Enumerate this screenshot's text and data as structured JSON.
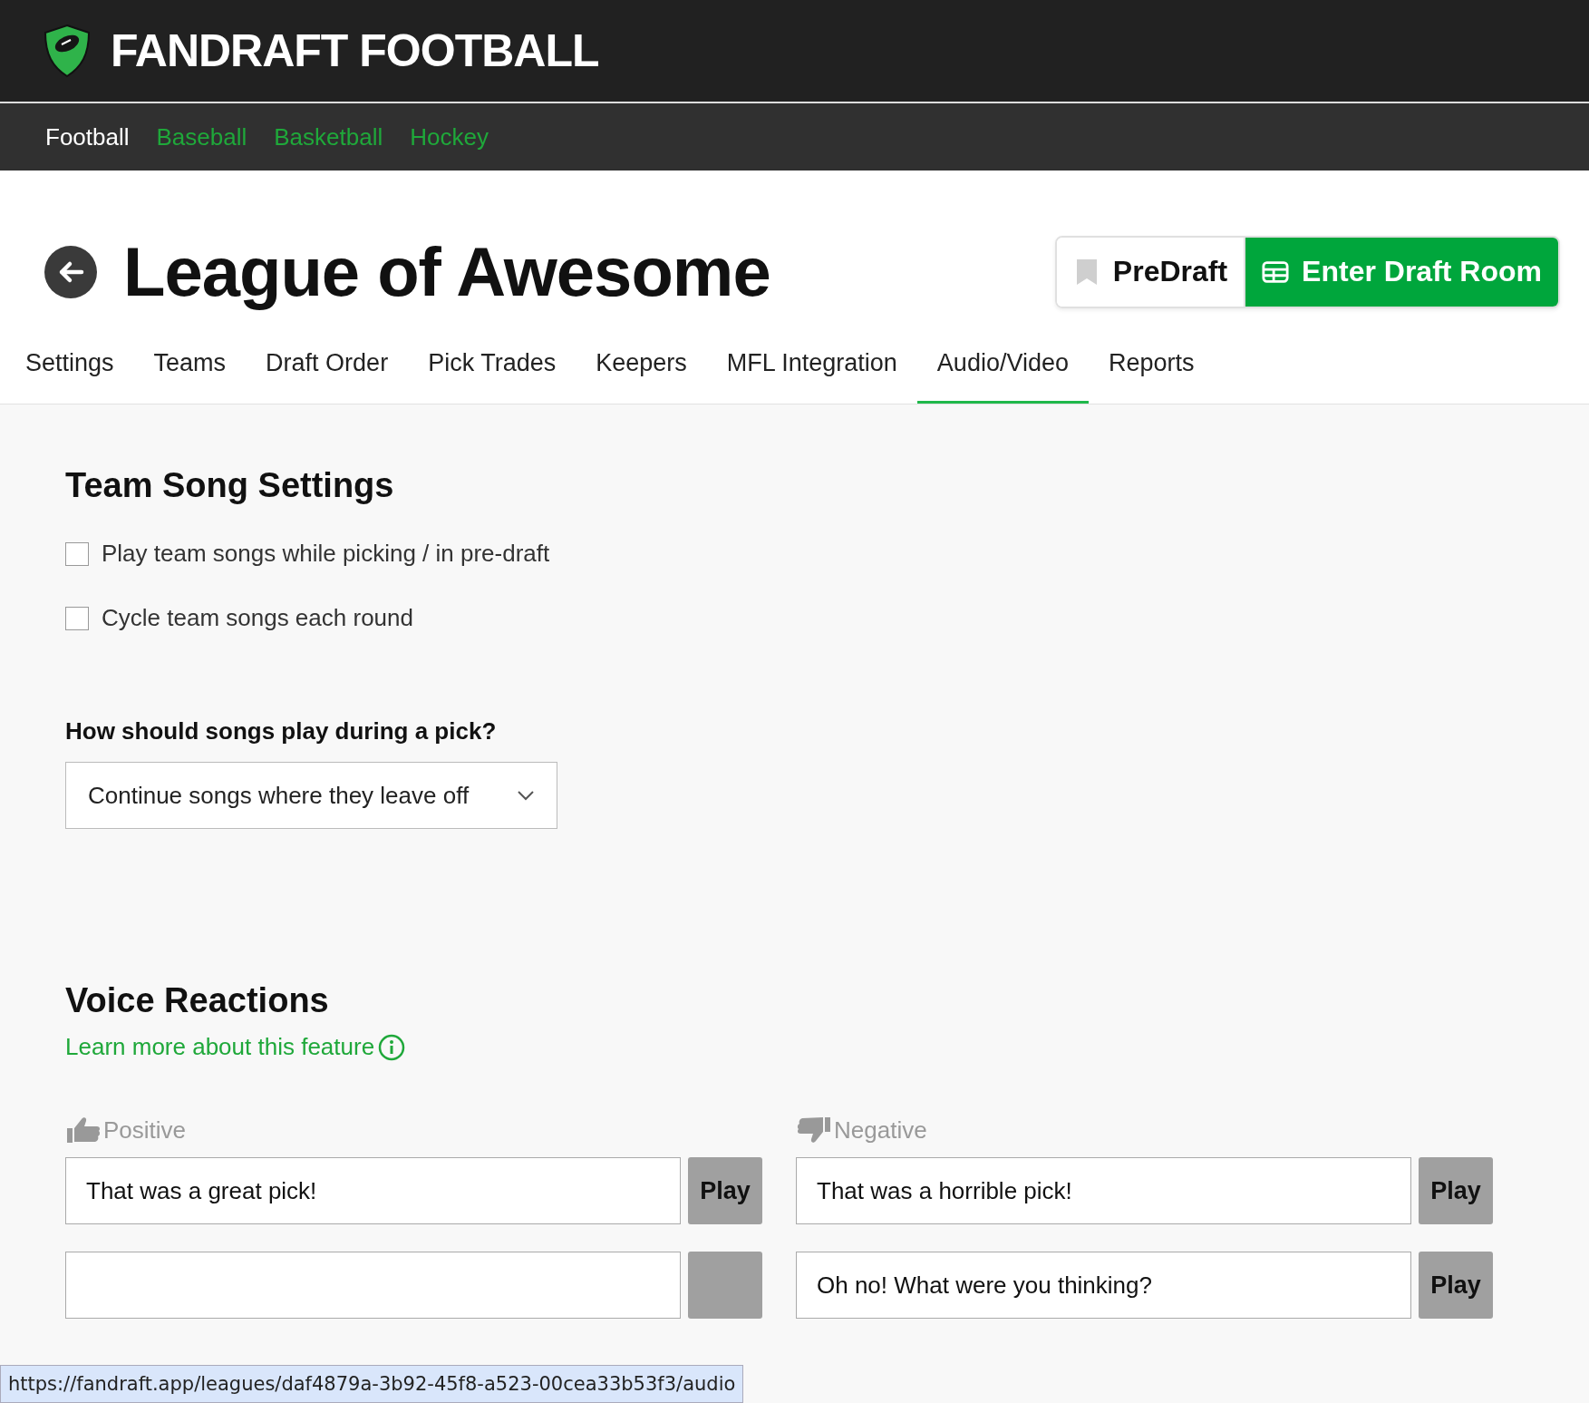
{
  "brand": {
    "name": "FANDRAFT FOOTBALL"
  },
  "sports_nav": [
    {
      "label": "Football",
      "selected": true
    },
    {
      "label": "Baseball",
      "selected": false
    },
    {
      "label": "Basketball",
      "selected": false
    },
    {
      "label": "Hockey",
      "selected": false
    }
  ],
  "league": {
    "title": "League of Awesome",
    "buttons": [
      {
        "label": "PreDraft",
        "kind": "secondary"
      },
      {
        "label": "Enter Draft Room",
        "kind": "primary"
      }
    ]
  },
  "tabs": [
    {
      "label": "Settings",
      "selected": false
    },
    {
      "label": "Teams",
      "selected": false
    },
    {
      "label": "Draft Order",
      "selected": false
    },
    {
      "label": "Pick Trades",
      "selected": false
    },
    {
      "label": "Keepers",
      "selected": false
    },
    {
      "label": "MFL Integration",
      "selected": false
    },
    {
      "label": "Audio/Video",
      "selected": true
    },
    {
      "label": "Reports",
      "selected": false
    }
  ],
  "team_song_settings": {
    "heading": "Team Song Settings",
    "options": [
      {
        "label": "Play team songs while picking / in pre-draft",
        "checked": false
      },
      {
        "label": "Cycle team songs each round",
        "checked": false
      }
    ],
    "question": "How should songs play during a pick?",
    "select": {
      "value": "Continue songs where they leave off"
    }
  },
  "voice_reactions": {
    "heading": "Voice Reactions",
    "link": "Learn more about this feature",
    "columns": [
      {
        "label": "Positive",
        "kind": "positive",
        "rows": [
          {
            "value": "That was a great pick!",
            "button": "Play"
          },
          {}
        ]
      },
      {
        "label": "Negative",
        "kind": "negative",
        "rows": [
          {
            "value": "That was a horrible pick!",
            "button": "Play"
          },
          {
            "value": "Oh no! What were you thinking?",
            "button": "Play"
          }
        ]
      }
    ]
  },
  "status_url": "https://fandraft.app/leagues/daf4879a-3b92-45f8-a523-00cea33b53f3/audio"
}
